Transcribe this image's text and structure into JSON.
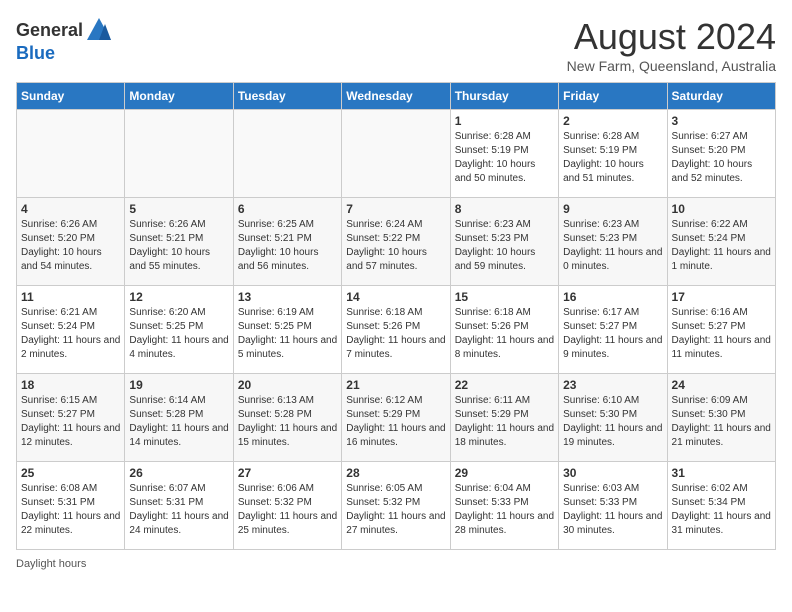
{
  "logo": {
    "text_general": "General",
    "text_blue": "Blue"
  },
  "title": {
    "month_year": "August 2024",
    "location": "New Farm, Queensland, Australia"
  },
  "days_of_week": [
    "Sunday",
    "Monday",
    "Tuesday",
    "Wednesday",
    "Thursday",
    "Friday",
    "Saturday"
  ],
  "weeks": [
    [
      {
        "day": "",
        "info": "",
        "empty": true
      },
      {
        "day": "",
        "info": "",
        "empty": true
      },
      {
        "day": "",
        "info": "",
        "empty": true
      },
      {
        "day": "",
        "info": "",
        "empty": true
      },
      {
        "day": "1",
        "info": "Sunrise: 6:28 AM\nSunset: 5:19 PM\nDaylight: 10 hours and 50 minutes."
      },
      {
        "day": "2",
        "info": "Sunrise: 6:28 AM\nSunset: 5:19 PM\nDaylight: 10 hours and 51 minutes."
      },
      {
        "day": "3",
        "info": "Sunrise: 6:27 AM\nSunset: 5:20 PM\nDaylight: 10 hours and 52 minutes."
      }
    ],
    [
      {
        "day": "4",
        "info": "Sunrise: 6:26 AM\nSunset: 5:20 PM\nDaylight: 10 hours and 54 minutes."
      },
      {
        "day": "5",
        "info": "Sunrise: 6:26 AM\nSunset: 5:21 PM\nDaylight: 10 hours and 55 minutes."
      },
      {
        "day": "6",
        "info": "Sunrise: 6:25 AM\nSunset: 5:21 PM\nDaylight: 10 hours and 56 minutes."
      },
      {
        "day": "7",
        "info": "Sunrise: 6:24 AM\nSunset: 5:22 PM\nDaylight: 10 hours and 57 minutes."
      },
      {
        "day": "8",
        "info": "Sunrise: 6:23 AM\nSunset: 5:23 PM\nDaylight: 10 hours and 59 minutes."
      },
      {
        "day": "9",
        "info": "Sunrise: 6:23 AM\nSunset: 5:23 PM\nDaylight: 11 hours and 0 minutes."
      },
      {
        "day": "10",
        "info": "Sunrise: 6:22 AM\nSunset: 5:24 PM\nDaylight: 11 hours and 1 minute."
      }
    ],
    [
      {
        "day": "11",
        "info": "Sunrise: 6:21 AM\nSunset: 5:24 PM\nDaylight: 11 hours and 2 minutes."
      },
      {
        "day": "12",
        "info": "Sunrise: 6:20 AM\nSunset: 5:25 PM\nDaylight: 11 hours and 4 minutes."
      },
      {
        "day": "13",
        "info": "Sunrise: 6:19 AM\nSunset: 5:25 PM\nDaylight: 11 hours and 5 minutes."
      },
      {
        "day": "14",
        "info": "Sunrise: 6:18 AM\nSunset: 5:26 PM\nDaylight: 11 hours and 7 minutes."
      },
      {
        "day": "15",
        "info": "Sunrise: 6:18 AM\nSunset: 5:26 PM\nDaylight: 11 hours and 8 minutes."
      },
      {
        "day": "16",
        "info": "Sunrise: 6:17 AM\nSunset: 5:27 PM\nDaylight: 11 hours and 9 minutes."
      },
      {
        "day": "17",
        "info": "Sunrise: 6:16 AM\nSunset: 5:27 PM\nDaylight: 11 hours and 11 minutes."
      }
    ],
    [
      {
        "day": "18",
        "info": "Sunrise: 6:15 AM\nSunset: 5:27 PM\nDaylight: 11 hours and 12 minutes."
      },
      {
        "day": "19",
        "info": "Sunrise: 6:14 AM\nSunset: 5:28 PM\nDaylight: 11 hours and 14 minutes."
      },
      {
        "day": "20",
        "info": "Sunrise: 6:13 AM\nSunset: 5:28 PM\nDaylight: 11 hours and 15 minutes."
      },
      {
        "day": "21",
        "info": "Sunrise: 6:12 AM\nSunset: 5:29 PM\nDaylight: 11 hours and 16 minutes."
      },
      {
        "day": "22",
        "info": "Sunrise: 6:11 AM\nSunset: 5:29 PM\nDaylight: 11 hours and 18 minutes."
      },
      {
        "day": "23",
        "info": "Sunrise: 6:10 AM\nSunset: 5:30 PM\nDaylight: 11 hours and 19 minutes."
      },
      {
        "day": "24",
        "info": "Sunrise: 6:09 AM\nSunset: 5:30 PM\nDaylight: 11 hours and 21 minutes."
      }
    ],
    [
      {
        "day": "25",
        "info": "Sunrise: 6:08 AM\nSunset: 5:31 PM\nDaylight: 11 hours and 22 minutes."
      },
      {
        "day": "26",
        "info": "Sunrise: 6:07 AM\nSunset: 5:31 PM\nDaylight: 11 hours and 24 minutes."
      },
      {
        "day": "27",
        "info": "Sunrise: 6:06 AM\nSunset: 5:32 PM\nDaylight: 11 hours and 25 minutes."
      },
      {
        "day": "28",
        "info": "Sunrise: 6:05 AM\nSunset: 5:32 PM\nDaylight: 11 hours and 27 minutes."
      },
      {
        "day": "29",
        "info": "Sunrise: 6:04 AM\nSunset: 5:33 PM\nDaylight: 11 hours and 28 minutes."
      },
      {
        "day": "30",
        "info": "Sunrise: 6:03 AM\nSunset: 5:33 PM\nDaylight: 11 hours and 30 minutes."
      },
      {
        "day": "31",
        "info": "Sunrise: 6:02 AM\nSunset: 5:34 PM\nDaylight: 11 hours and 31 minutes."
      }
    ]
  ],
  "footer": {
    "daylight_label": "Daylight hours"
  }
}
